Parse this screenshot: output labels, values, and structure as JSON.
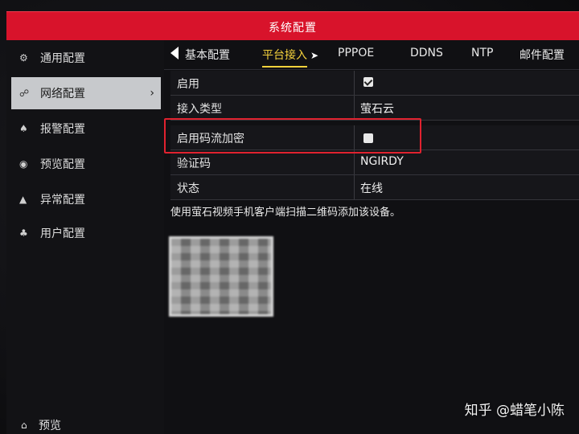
{
  "window": {
    "title": "系统配置"
  },
  "sidebar": {
    "items": [
      {
        "label": "通用配置",
        "icon": "gear-icon",
        "glyph": "⚙"
      },
      {
        "label": "网络配置",
        "icon": "network-icon",
        "glyph": "☍",
        "active": true,
        "chevron": "›"
      },
      {
        "label": "报警配置",
        "icon": "alarm-bell-icon",
        "glyph": "♠"
      },
      {
        "label": "预览配置",
        "icon": "eye-icon",
        "glyph": "◉"
      },
      {
        "label": "异常配置",
        "icon": "warning-icon",
        "glyph": "▲"
      },
      {
        "label": "用户配置",
        "icon": "users-icon",
        "glyph": "♣"
      }
    ],
    "bottom": {
      "label": "预览",
      "icon": "home-icon",
      "glyph": "⌂"
    }
  },
  "tabs": {
    "back_icon": "back-arrow-icon",
    "items": [
      "基本配置",
      "平台接入",
      "PPPOE",
      "DDNS",
      "NTP",
      "邮件配置"
    ],
    "active_index": 1
  },
  "form": {
    "rows": [
      {
        "label": "启用",
        "type": "checkbox",
        "checked": true
      },
      {
        "label": "接入类型",
        "type": "text",
        "value": "萤石云"
      },
      {
        "label": "启用码流加密",
        "type": "checkbox",
        "checked": false,
        "highlighted": true
      },
      {
        "label": "验证码",
        "type": "text",
        "value": "NGIRDY"
      },
      {
        "label": "状态",
        "type": "text",
        "value": "在线"
      }
    ]
  },
  "description": "使用萤石视频手机客户端扫描二维码添加该设备。",
  "watermark": "知乎 @蜡笔小陈",
  "colors": {
    "titlebar": "#d8132b",
    "active_tab": "#f5d23c",
    "highlight_box": "#e0222f"
  }
}
